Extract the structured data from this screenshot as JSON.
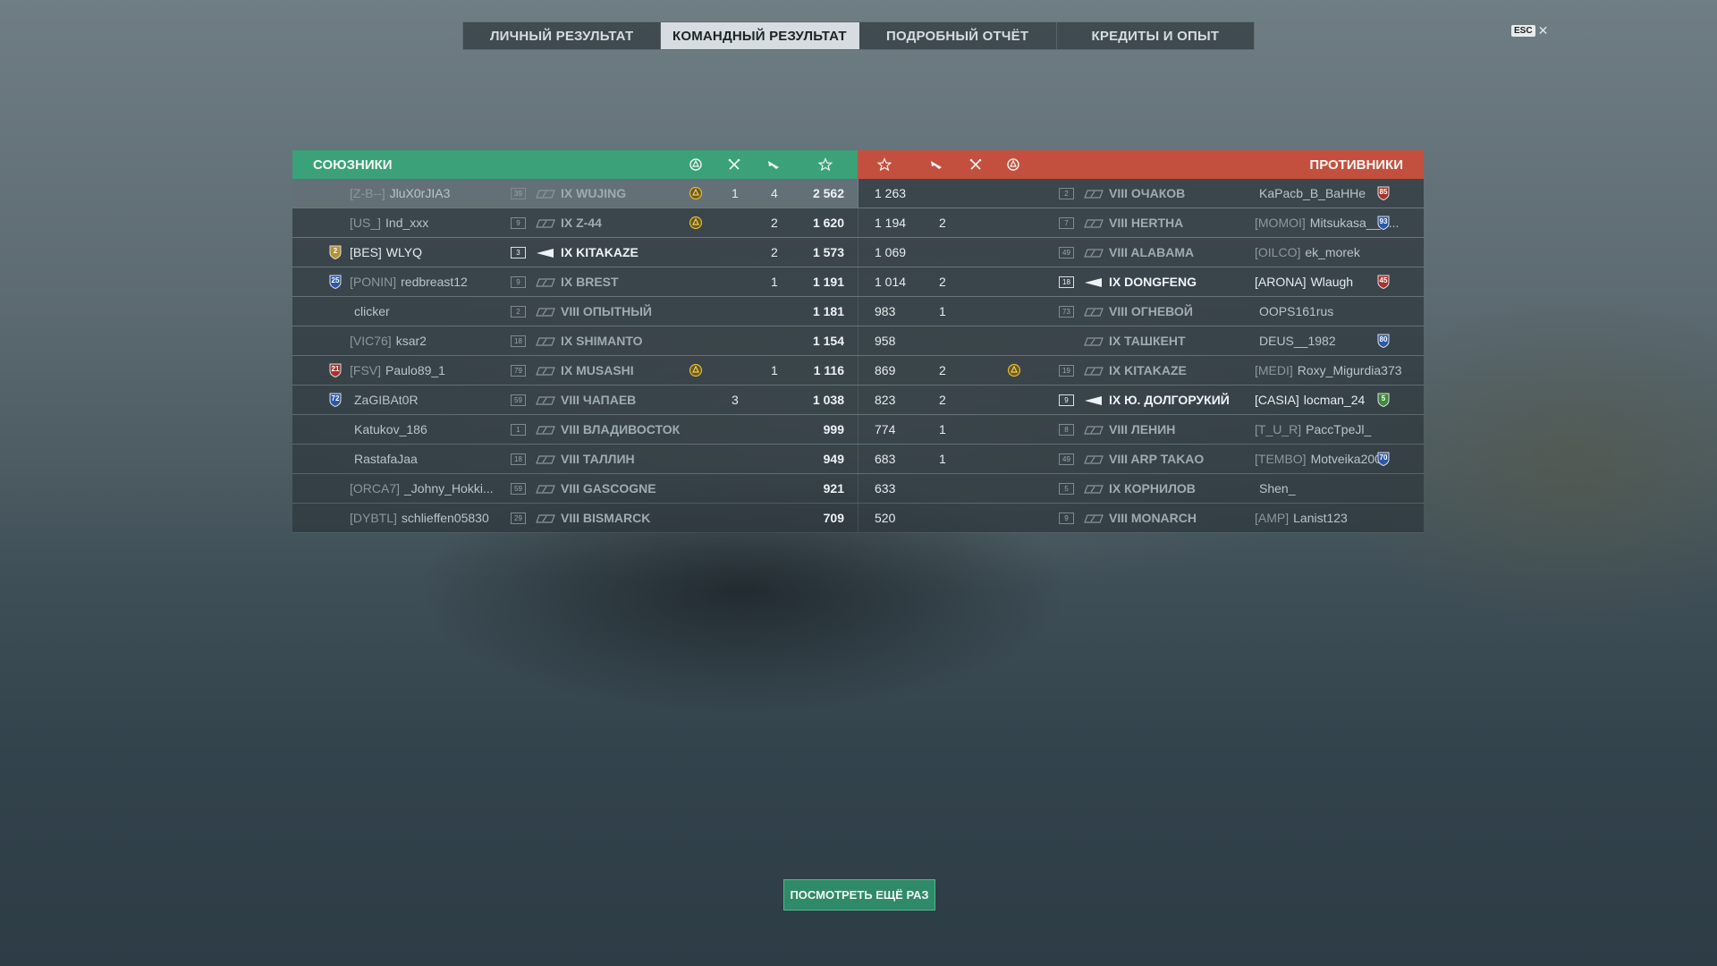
{
  "tabs": [
    {
      "label": "ЛИЧНЫЙ РЕЗУЛЬТАТ",
      "active": false
    },
    {
      "label": "КОМАНДНЫЙ РЕЗУЛЬТАТ",
      "active": true
    },
    {
      "label": "ПОДРОБНЫЙ ОТЧЁТ",
      "active": false
    },
    {
      "label": "КРЕДИТЫ И ОПЫТ",
      "active": false
    }
  ],
  "esc_label": "ESC",
  "close_glyph": "✕",
  "allies": {
    "title": "СОЮЗНИКИ",
    "color": "#3aa178",
    "columns": [
      "base-capture-icon",
      "kills-icon",
      "planes-icon",
      "star-icon"
    ],
    "rows": [
      {
        "clan_rank": "",
        "clan_tag": "[Z-B--]",
        "name": "JluX0rJIA3",
        "level": "39",
        "ship": "IX WUJING",
        "capture": true,
        "kills": "1",
        "planes": "4",
        "xp": "2 562",
        "highlight": true
      },
      {
        "clan_rank": "",
        "clan_tag": "[US_]",
        "name": "Ind_xxx",
        "level": "9",
        "ship": "IX Z-44",
        "capture": true,
        "kills": "",
        "planes": "2",
        "xp": "1 620"
      },
      {
        "clan_rank": "2",
        "clan_tag": "[BES]",
        "name": "WLYQ",
        "level": "3",
        "ship": "IX KITAKAZE",
        "capture": false,
        "kills": "",
        "planes": "2",
        "xp": "1 573",
        "self": true
      },
      {
        "clan_rank": "25",
        "clan_tag": "[PONIN]",
        "name": "redbreast12",
        "level": "9",
        "ship": "IX BREST",
        "capture": false,
        "kills": "",
        "planes": "1",
        "xp": "1 191"
      },
      {
        "clan_rank": "",
        "clan_tag": "",
        "name": "clicker",
        "level": "2",
        "ship": "VIII ОПЫТНЫЙ",
        "capture": false,
        "kills": "",
        "planes": "",
        "xp": "1 181"
      },
      {
        "clan_rank": "",
        "clan_tag": "[VIC76]",
        "name": "ksar2",
        "level": "18",
        "ship": "IX SHIMANTO",
        "capture": false,
        "kills": "",
        "planes": "",
        "xp": "1 154"
      },
      {
        "clan_rank": "21",
        "clan_tag": "[FSV]",
        "name": "Paulo89_1",
        "level": "79",
        "ship": "IX MUSASHI",
        "capture": true,
        "kills": "",
        "planes": "1",
        "xp": "1 116"
      },
      {
        "clan_rank": "72",
        "clan_tag": "",
        "name": "ZaGIBAt0R",
        "level": "59",
        "ship": "VIII ЧАПАЕВ",
        "capture": false,
        "kills": "3",
        "planes": "",
        "xp": "1 038"
      },
      {
        "clan_rank": "",
        "clan_tag": "",
        "name": "Katukov_186",
        "level": "1",
        "ship": "VIII ВЛАДИВОСТОК",
        "capture": false,
        "kills": "",
        "planes": "",
        "xp": "999"
      },
      {
        "clan_rank": "",
        "clan_tag": "",
        "name": "RastafaJaa",
        "level": "18",
        "ship": "VIII ТАЛЛИН",
        "capture": false,
        "kills": "",
        "planes": "",
        "xp": "949"
      },
      {
        "clan_rank": "",
        "clan_tag": "[ORCA7]",
        "name": "_Johny_Hokki...",
        "level": "59",
        "ship": "VIII GASCOGNE",
        "capture": false,
        "kills": "",
        "planes": "",
        "xp": "921"
      },
      {
        "clan_rank": "",
        "clan_tag": "[DYBTL]",
        "name": "schlieffen05830",
        "level": "29",
        "ship": "VIII BISMARCK",
        "capture": false,
        "kills": "",
        "planes": "",
        "xp": "709"
      }
    ]
  },
  "enemies": {
    "title": "ПРОТИВНИКИ",
    "color": "#c3503f",
    "rows": [
      {
        "xp": "1 263",
        "planes": "",
        "kills": "",
        "capture": false,
        "level": "2",
        "ship": "VIII ОЧАКОВ",
        "clan_tag": "",
        "name": "KaPacb_B_BaHHe",
        "rank": "85",
        "rank_color": "red"
      },
      {
        "xp": "1 194",
        "planes": "2",
        "kills": "",
        "capture": false,
        "level": "7",
        "ship": "VIII HERTHA",
        "clan_tag": "[MOMOI]",
        "name": "Mitsukasa__A...",
        "rank": "93",
        "rank_color": "blue"
      },
      {
        "xp": "1 069",
        "planes": "",
        "kills": "",
        "capture": false,
        "level": "49",
        "ship": "VIII ALABAMA",
        "clan_tag": "[OILCO]",
        "name": "ek_morek",
        "rank": "",
        "rank_color": ""
      },
      {
        "xp": "1 014",
        "planes": "2",
        "kills": "",
        "capture": false,
        "level": "18",
        "ship": "IX DONGFENG",
        "clan_tag": "[ARONA]",
        "name": "Wlaugh",
        "rank": "45",
        "rank_color": "red",
        "bright": true
      },
      {
        "xp": "983",
        "planes": "1",
        "kills": "",
        "capture": false,
        "level": "73",
        "ship": "VIII ОГНЕВОЙ",
        "clan_tag": "",
        "name": "OOPS161rus",
        "rank": "",
        "rank_color": ""
      },
      {
        "xp": "958",
        "planes": "",
        "kills": "",
        "capture": false,
        "level": "",
        "ship": "IX ТАШКЕНТ",
        "clan_tag": "",
        "name": "DEUS__1982",
        "rank": "80",
        "rank_color": "blue"
      },
      {
        "xp": "869",
        "planes": "2",
        "kills": "",
        "capture": true,
        "level": "19",
        "ship": "IX KITAKAZE",
        "clan_tag": "[MEDI]",
        "name": "Roxy_Migurdia373",
        "rank": "",
        "rank_color": ""
      },
      {
        "xp": "823",
        "planes": "2",
        "kills": "",
        "capture": false,
        "level": "9",
        "ship": "IX Ю. ДОЛГОРУКИЙ",
        "clan_tag": "[CASIA]",
        "name": "locman_24",
        "rank": "5",
        "rank_color": "green",
        "bright": true
      },
      {
        "xp": "774",
        "planes": "1",
        "kills": "",
        "capture": false,
        "level": "8",
        "ship": "VIII ЛЕНИН",
        "clan_tag": "[T_U_R]",
        "name": "PaccTpeJl_",
        "rank": "",
        "rank_color": ""
      },
      {
        "xp": "683",
        "planes": "1",
        "kills": "",
        "capture": false,
        "level": "49",
        "ship": "VIII ARP TAKAO",
        "clan_tag": "[TEMBO]",
        "name": "Motveika2005",
        "rank": "70",
        "rank_color": "blue"
      },
      {
        "xp": "633",
        "planes": "",
        "kills": "",
        "capture": false,
        "level": "5",
        "ship": "IX КОРНИЛОВ",
        "clan_tag": "",
        "name": "Shen_",
        "rank": "",
        "rank_color": ""
      },
      {
        "xp": "520",
        "planes": "",
        "kills": "",
        "capture": false,
        "level": "9",
        "ship": "VIII MONARCH",
        "clan_tag": "[AMP]",
        "name": "Lanist123",
        "rank": "",
        "rank_color": ""
      }
    ]
  },
  "replay_button": "ПОСМОТРЕТЬ ЕЩЁ РАЗ"
}
